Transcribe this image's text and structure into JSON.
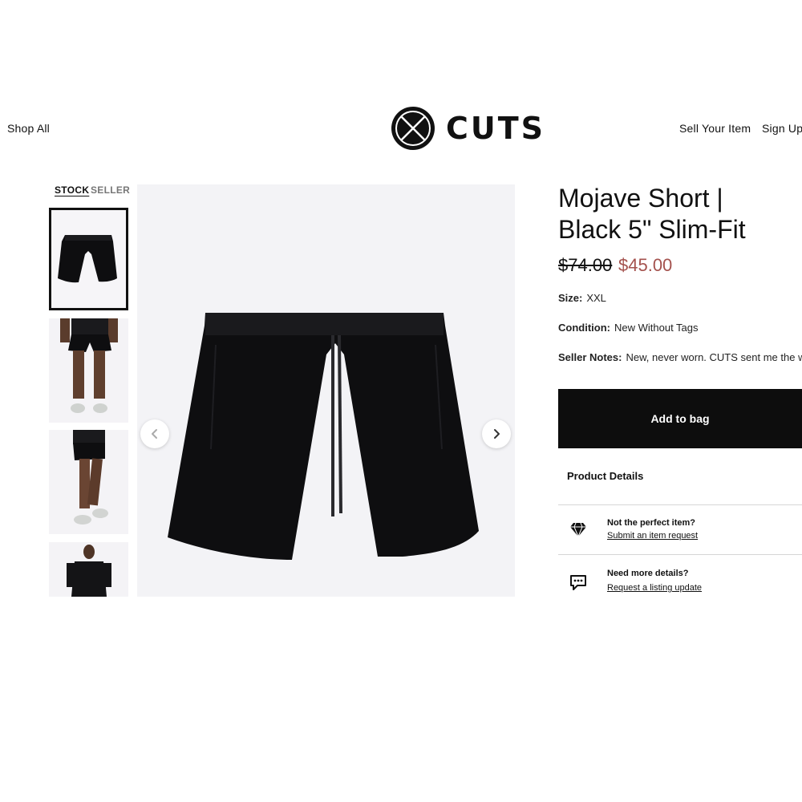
{
  "header": {
    "shop_all": "Shop All",
    "brand": "CUTS",
    "sell_item": "Sell Your Item",
    "sign_up": "Sign Up"
  },
  "gallery": {
    "source_tabs": [
      "STOCK",
      "SELLER"
    ],
    "active_source": "STOCK",
    "active_thumbnail_index": 0,
    "colors": {
      "background": "#f3f3f6",
      "product": "#0e0e10"
    }
  },
  "product": {
    "title_line1": "Mojave Short |",
    "title_line2": "Black 5\" Slim-Fit",
    "price_original": "$74.00",
    "price_sale": "$45.00",
    "sale_color": "#a4524e",
    "size_label": "Size:",
    "size_value": "XXL",
    "condition_label": "Condition:",
    "condition_value": "New Without Tags",
    "notes_label": "Seller Notes:",
    "notes_value": "New, never worn. CUTS sent me the wro"
  },
  "actions": {
    "add_to_bag": "Add to bag",
    "product_details": "Product Details"
  },
  "help": [
    {
      "icon": "diamond-icon",
      "question": "Not the perfect item?",
      "link": "Submit an item request"
    },
    {
      "icon": "chat-bubble-icon",
      "question": "Need more details?",
      "link": "Request a listing update"
    }
  ]
}
